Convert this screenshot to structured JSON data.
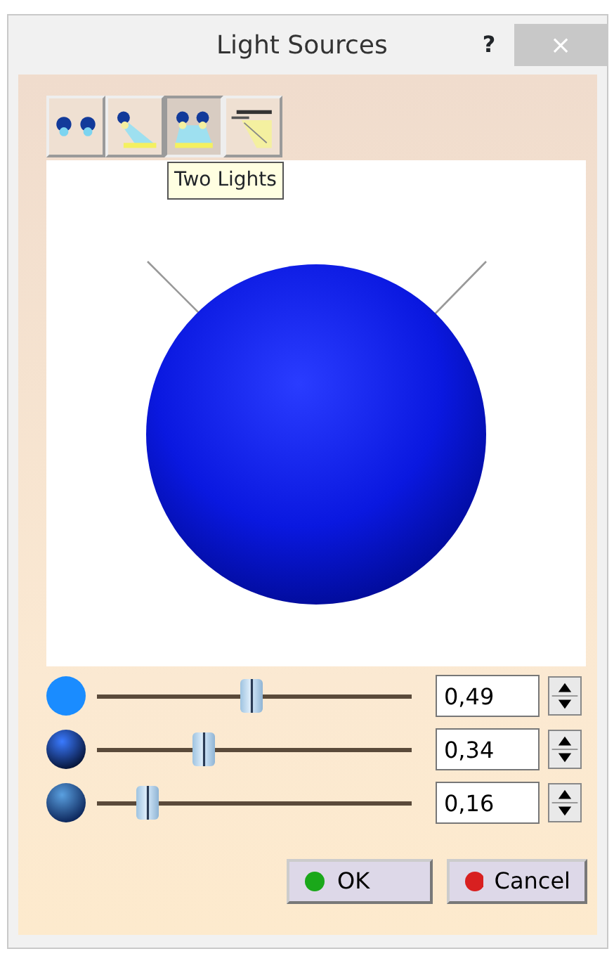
{
  "window": {
    "title": "Light Sources",
    "help": "?",
    "close": "×"
  },
  "tools": [
    {
      "selected": false
    },
    {
      "selected": false
    },
    {
      "selected": true
    },
    {
      "selected": false
    }
  ],
  "tooltip": "Two Lights",
  "sliders": [
    {
      "level": 0.49,
      "value": "0,49"
    },
    {
      "level": 0.34,
      "value": "0,34"
    },
    {
      "level": 0.16,
      "value": "0,16"
    }
  ],
  "buttons": [
    {
      "label": "OK",
      "kind": "ok"
    },
    {
      "label": "Cancel",
      "kind": "cancel"
    }
  ]
}
